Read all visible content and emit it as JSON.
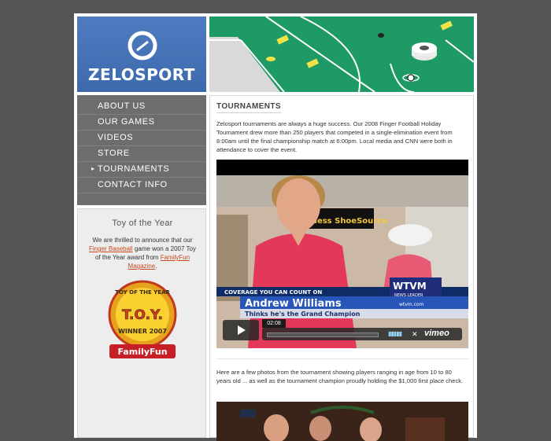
{
  "brand": {
    "name": "ZELOSPORT"
  },
  "nav": {
    "items": [
      {
        "label": "ABOUT US",
        "active": false
      },
      {
        "label": "OUR GAMES",
        "active": false
      },
      {
        "label": "VIDEOS",
        "active": false
      },
      {
        "label": "STORE",
        "active": false
      },
      {
        "label": "TOURNAMENTS",
        "active": true
      },
      {
        "label": "CONTACT INFO",
        "active": false
      }
    ]
  },
  "toy_box": {
    "title": "Toy of the Year",
    "text_1": "We are thrilled to announce that our",
    "link_1": "Finger Baseball",
    "text_2": "game won a 2007 Toy of the Year award from",
    "link_2": "FamilyFun Magazine",
    "text_3": ".",
    "badge": {
      "top": "TOY OF THE YEAR",
      "mid": "T.O.Y.",
      "winner": "WINNER 2007",
      "brand": "FamilyFun"
    }
  },
  "content": {
    "title": "TOURNAMENTS",
    "intro": "Zelosport tournaments are always a huge success. Our 2008 Finger Football Holiday Tournament drew more than 250 players that competed in a single-elimination event from 8:00am until the final championship match at 6:00pm. Local media and CNN were both in attendance to cover the event.",
    "video": {
      "store_sign": "yless ShoeSource",
      "coverage": "COVERAGE YOU CAN COUNT ON",
      "station": "WTVM",
      "station_sub": "NEWS LEADER",
      "station_url": "wtvm.com",
      "name": "Andrew Williams",
      "caption": "Thinks he's the Grand Champion",
      "time": "02:08",
      "provider": "vimeo"
    },
    "photos_text": "Here are a few photos from the tournament showing players ranging in age from 10 to 80 years old ... as well as the tournament champion proudly holding the $1,000 first place check."
  },
  "colors": {
    "background": "#555555",
    "logo_blue": "#4a76bb",
    "banner_green": "#1f9a66",
    "nav_gray": "#6d6d6d",
    "link": "#c64a1e"
  }
}
